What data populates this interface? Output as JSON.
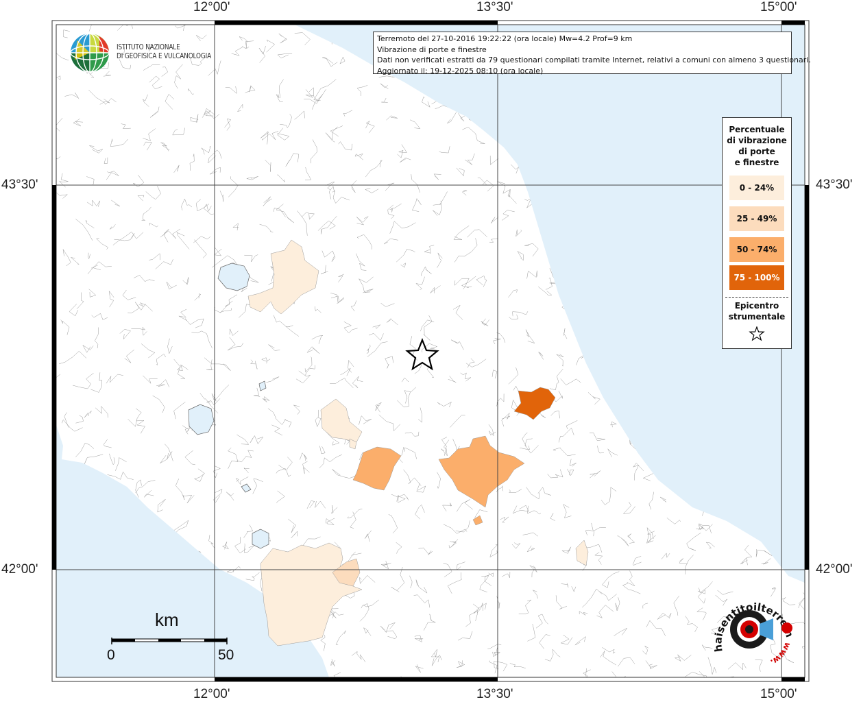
{
  "info": {
    "line1": "Terremoto del 27-10-2016 19:22:22 (ora locale) Mw=4.2 Prof=9 km",
    "line2": "Vibrazione di porte e finestre",
    "line3": "Dati non verificati estratti da 79 questionari compilati tramite Internet, relativi a comuni con almeno 3 questionari.",
    "line4": "Aggiornato il: 19-12-2025 08:10 (ora locale)"
  },
  "logo": {
    "line1": "ISTITUTO NAZIONALE",
    "line2": "DI GEOFISICA E VULCANOLOGIA"
  },
  "axes": {
    "top": [
      "12°00'",
      "13°30'",
      "15°00'"
    ],
    "bottom": [
      "12°00'",
      "13°30'",
      "15°00'"
    ],
    "left": [
      "43°30'",
      "42°00'"
    ],
    "right": [
      "43°30'",
      "42°00'"
    ]
  },
  "legend": {
    "title_lines": [
      "Percentuale",
      "di vibrazione",
      "di porte",
      "e finestre"
    ],
    "items": [
      {
        "label": "0 - 24%",
        "color": "#fdeedc"
      },
      {
        "label": "25 - 49%",
        "color": "#fcdcbd"
      },
      {
        "label": "50 - 74%",
        "color": "#fbae6b"
      },
      {
        "label": "75 - 100%",
        "color": "#e1640a"
      }
    ],
    "epicenter_lines": [
      "Epicentro",
      "strumentale"
    ],
    "epicenter_icon": "star-icon"
  },
  "scale": {
    "unit": "km",
    "start": "0",
    "end": "50"
  },
  "brand": {
    "text": "haisentitoilterremoto.it",
    "url_text": "www.",
    "icon": "speaker-icon"
  },
  "colors": {
    "sea": "#e1f0fa",
    "land": "#ffffff",
    "epicenter": "#000000"
  }
}
